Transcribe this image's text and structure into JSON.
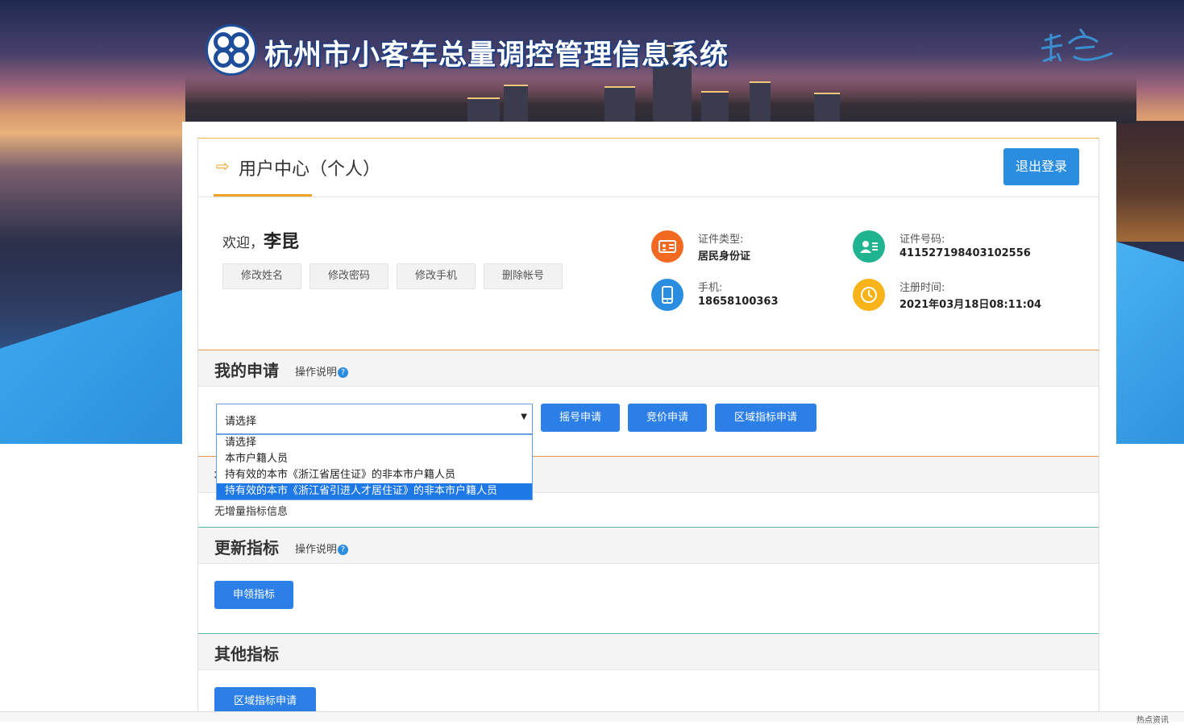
{
  "header": {
    "system_title": "杭州市小客车总量调控管理信息系统"
  },
  "user_center": {
    "title": "用户中心（个人）",
    "logout_label": "退出登录",
    "welcome_prefix": "欢迎，",
    "user_name": "李昆",
    "actions": [
      "修改姓名",
      "修改密码",
      "修改手机",
      "删除帐号"
    ],
    "info": {
      "id_type_label": "证件类型:",
      "id_type_value": "居民身份证",
      "id_number_label": "证件号码:",
      "id_number_value": "411527198403102556",
      "phone_label": "手机:",
      "phone_value": "18658100363",
      "register_label": "注册时间:",
      "register_value": "2021年03月18日08:11:04"
    }
  },
  "my_application": {
    "title": "我的申请",
    "help_label": "操作说明",
    "select_value": "请选择",
    "options": [
      "请选择",
      "本市户籍人员",
      "持有效的本市《浙江省居住证》的非本市户籍人员",
      "持有效的本市《浙江省引进人才居住证》的非本市户籍人员"
    ],
    "highlighted_option_index": 3,
    "buttons": [
      "摇号申请",
      "竞价申请",
      "区域指标申请"
    ]
  },
  "increment": {
    "partial_title": "增",
    "empty_text": "无增量指标信息"
  },
  "update_indicator": {
    "title": "更新指标",
    "help_label": "操作说明",
    "button_label": "申领指标"
  },
  "other_indicator": {
    "title": "其他指标",
    "button_label": "区域指标申请"
  },
  "statusbar": {
    "text": "热点资讯"
  },
  "colors": {
    "primary_blue": "#2b7fe6",
    "accent_orange": "#f0a12b",
    "icon_orange": "#f26a22",
    "icon_teal": "#1fb38f",
    "icon_blue": "#2b8de0",
    "icon_yellow": "#f7b318"
  }
}
